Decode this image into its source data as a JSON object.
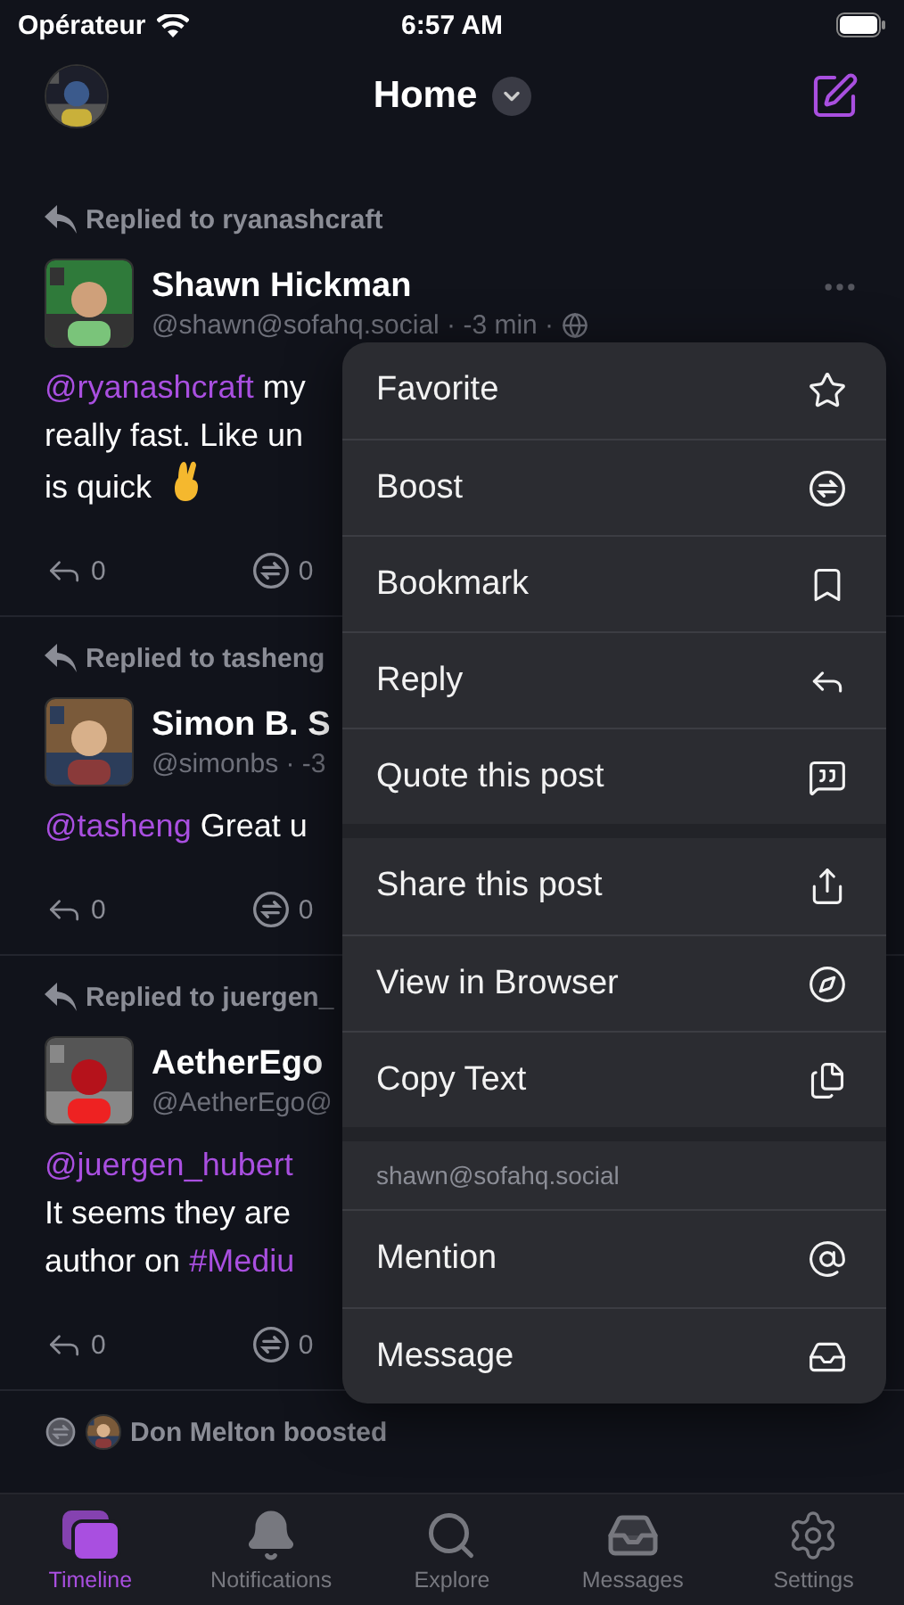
{
  "status_bar": {
    "carrier": "Opérateur",
    "time": "6:57 AM"
  },
  "header": {
    "title": "Home"
  },
  "posts": [
    {
      "context": "Replied to ryanashcraft",
      "kind": "reply",
      "name": "Shawn Hickman",
      "handle": "@shawn@sofahq.social · -3 min ·",
      "more": true,
      "lines": [
        [
          {
            "kind": "mention",
            "text": "@ryanashcraft"
          },
          {
            "kind": "text",
            "text": " my"
          }
        ],
        [
          {
            "kind": "text",
            "text": "really fast. Like un"
          }
        ],
        [
          {
            "kind": "text",
            "text": "is quick"
          }
        ]
      ],
      "emoji": true,
      "replies": "0",
      "boosts": "0"
    },
    {
      "context": "Replied to tasheng",
      "kind": "reply",
      "name": "Simon B. S",
      "handle": "@simonbs · -3",
      "more": false,
      "lines": [
        [
          {
            "kind": "mention",
            "text": "@tasheng"
          },
          {
            "kind": "text",
            "text": " Great u"
          }
        ]
      ],
      "emoji": false,
      "replies": "0",
      "boosts": "0"
    },
    {
      "context": "Replied to juergen_",
      "kind": "reply",
      "name": "AetherEgo",
      "handle": "@AetherEgo@",
      "more": false,
      "lines": [
        [
          {
            "kind": "mention",
            "text": "@juergen_hubert"
          }
        ],
        [
          {
            "kind": "text",
            "text": "It seems they are"
          }
        ],
        [
          {
            "kind": "text",
            "text": "author on "
          },
          {
            "kind": "hashtag",
            "text": "#Mediu"
          }
        ]
      ],
      "emoji": false,
      "replies": "0",
      "boosts": "0"
    },
    {
      "context": "Don Melton boosted",
      "kind": "boost"
    }
  ],
  "menu": {
    "groups": [
      {
        "items": [
          "Favorite",
          "Boost",
          "Bookmark",
          "Reply",
          "Quote this post"
        ]
      },
      {
        "items": [
          "Share this post",
          "View in Browser",
          "Copy Text"
        ]
      },
      {
        "title": "shawn@sofahq.social",
        "items": [
          "Mention",
          "Message"
        ]
      }
    ]
  },
  "tabs": [
    {
      "label": "Timeline",
      "selected": true
    },
    {
      "label": "Notifications",
      "selected": false
    },
    {
      "label": "Explore",
      "selected": false
    },
    {
      "label": "Messages",
      "selected": false
    },
    {
      "label": "Settings",
      "selected": false
    }
  ]
}
